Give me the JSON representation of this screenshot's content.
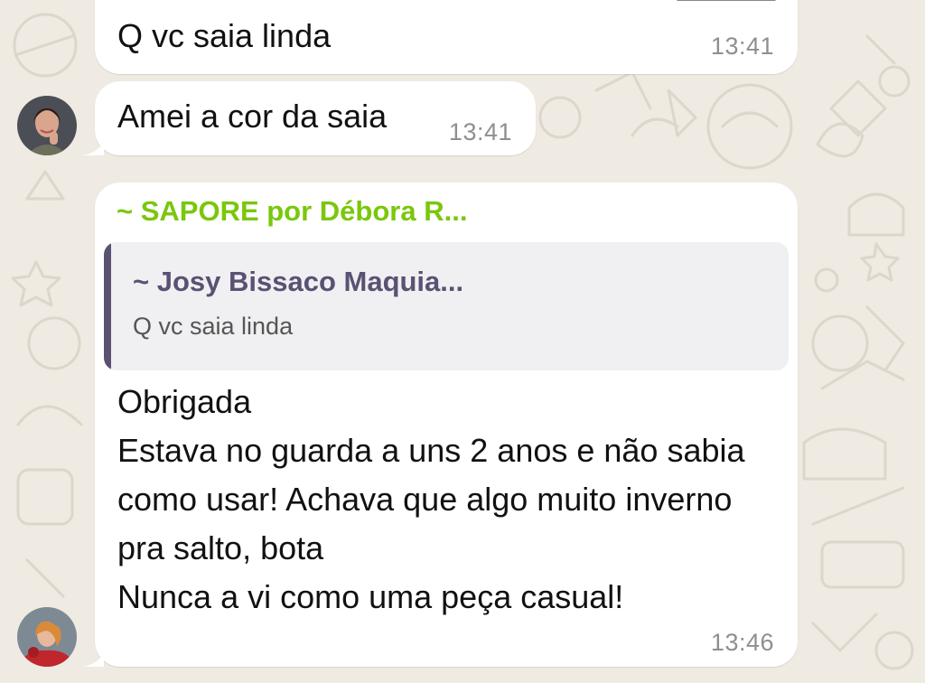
{
  "chat": {
    "messages": [
      {
        "text": "Q vc saia linda",
        "time": "13:41"
      },
      {
        "text": "Amei a cor da saia",
        "time": "13:41"
      },
      {
        "sender": "~ SAPORE por Débora R...",
        "quote": {
          "author": "~ Josy Bissaco Maquia...",
          "text": "Q vc saia linda"
        },
        "text": "Obrigada\nEstava no guarda a uns 2 anos e não sabia como usar! Achava que algo muito inverno pra salto, bota\nNunca a vi como uma peça casual!",
        "time": "13:46"
      }
    ]
  },
  "colors": {
    "background": "#efeae2",
    "bubble": "#ffffff",
    "sender_name": "#7ac70c",
    "quote_accent": "#5a5173",
    "timestamp": "#8f8f8f"
  }
}
